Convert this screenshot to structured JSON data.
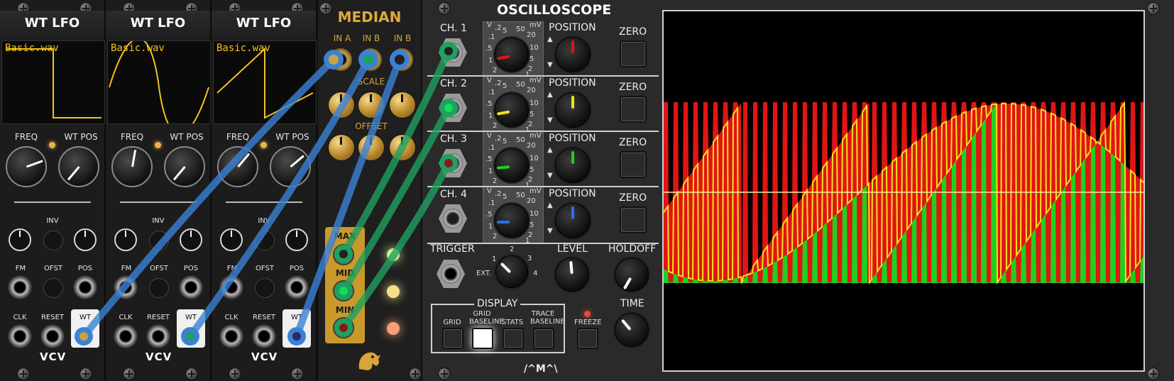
{
  "wt_lfos": [
    {
      "title": "WT LFO",
      "file": "Basic.wav",
      "wave": "square"
    },
    {
      "title": "WT LFO",
      "file": "Basic.wav",
      "wave": "sine"
    },
    {
      "title": "WT LFO",
      "file": "Basic.wav",
      "wave": "saw"
    }
  ],
  "wt_labels": {
    "freq": "FREQ",
    "wt_pos": "WT POS",
    "inv": "INV",
    "fm": "FM",
    "ofst": "OFST",
    "pos": "POS",
    "clk": "CLK",
    "reset": "RESET",
    "wt": "WT",
    "brand": "VCV"
  },
  "median": {
    "title": "MEDIAN",
    "inputs": [
      "IN A",
      "IN B",
      "IN B"
    ],
    "scale": "SCALE",
    "offset": "OFFSET",
    "outputs": [
      "MAX",
      "MID",
      "MIN"
    ],
    "led_colors": [
      "#c8f08c",
      "#f7e08a",
      "#f6a07a"
    ]
  },
  "scope": {
    "title": "OSCILLOSCOPE",
    "channels": [
      {
        "label": "CH. 1",
        "position": "POSITION",
        "zero": "ZERO",
        "color": "#e01515"
      },
      {
        "label": "CH. 2",
        "position": "POSITION",
        "zero": "ZERO",
        "color": "#f2e21a"
      },
      {
        "label": "CH. 3",
        "position": "POSITION",
        "zero": "ZERO",
        "color": "#1ed11e"
      },
      {
        "label": "CH. 4",
        "position": "POSITION",
        "zero": "ZERO",
        "color": "#2a6ff0"
      }
    ],
    "scale_left": {
      "unit": "V",
      "ticks": [
        ".2",
        ".1",
        ".5",
        "1",
        "2",
        "5"
      ]
    },
    "scale_right": {
      "unit": "mV",
      "ticks": [
        "50",
        "20",
        "10",
        "5",
        "2",
        "1"
      ]
    },
    "trigger": "TRIGGER",
    "ext": "EXT.",
    "trigger_ticks": [
      "1",
      "2",
      "3",
      "4"
    ],
    "level": "LEVEL",
    "holdoff": "HOLDOFF",
    "display": "DISPLAY",
    "display_buttons": [
      "GRID",
      "GRID\nBASELINE",
      "STATS",
      "TRACE\nBASELINE"
    ],
    "freeze": "FREEZE",
    "time": "TIME",
    "brand": "/^M^\\"
  }
}
